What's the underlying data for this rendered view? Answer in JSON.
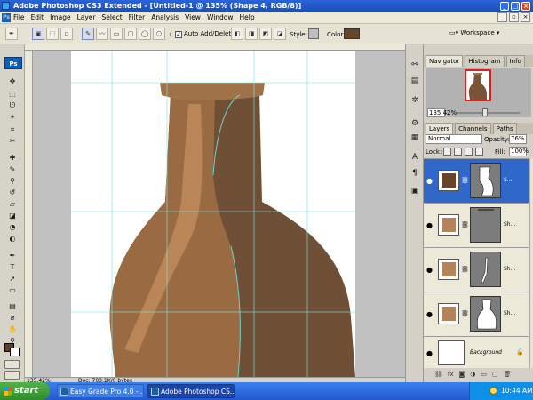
{
  "window": {
    "title": "Adobe Photoshop CS3 Extended - [Untitled-1 @ 135% (Shape 4, RGB/8)]",
    "controls": {
      "minimize": "_",
      "maximize": "□",
      "close": "×"
    }
  },
  "menubar": {
    "items": [
      "File",
      "Edit",
      "Image",
      "Layer",
      "Select",
      "Filter",
      "Analysis",
      "View",
      "Window",
      "Help"
    ],
    "doc_controls": {
      "minimize": "_",
      "restore": "▫",
      "close": "×"
    }
  },
  "options": {
    "auto_add_delete": "Auto Add/Delete",
    "auto_add_checked": true,
    "style_label": "Style:",
    "color_label": "Color:",
    "color_value": "#6a4428",
    "workspace": "Workspace"
  },
  "tools": {
    "badge": "Ps",
    "icons": [
      "move-icon",
      "marquee-icon",
      "lasso-icon",
      "magic-wand-icon",
      "crop-icon",
      "slice-icon",
      "healing-icon",
      "brush-icon",
      "stamp-icon",
      "history-brush-icon",
      "eraser-icon",
      "gradient-icon",
      "blur-icon",
      "dodge-icon",
      "pen-icon",
      "type-icon",
      "path-select-icon",
      "shape-icon",
      "notes-icon",
      "eyedropper-icon",
      "hand-icon",
      "zoom-icon"
    ]
  },
  "document": {
    "zoom": "135.42%",
    "doc_size": "Doc: 703.1K/0 bytes",
    "colors": {
      "dark": "#6f4f35",
      "mid": "#9a6b42",
      "light": "#c0895a"
    }
  },
  "navigator": {
    "tabs": [
      "Navigator",
      "Histogram",
      "Info"
    ],
    "zoom": "135.42%"
  },
  "layers": {
    "tabs": [
      "Layers",
      "Channels",
      "Paths"
    ],
    "blend_mode": "Normal",
    "opacity_label": "Opacity:",
    "opacity": "76%",
    "lock_label": "Lock:",
    "fill_label": "Fill:",
    "fill": "100%",
    "items": [
      {
        "name": "S...",
        "color": "#6a4428",
        "selected": true
      },
      {
        "name": "Sh...",
        "color": "#b5825a",
        "selected": false
      },
      {
        "name": "Sh...",
        "color": "#b5825a",
        "selected": false
      },
      {
        "name": "Sh...",
        "color": "#b5825a",
        "selected": false
      },
      {
        "name": "Background",
        "color": "#ffffff",
        "selected": false
      }
    ]
  },
  "taskbar": {
    "start": "start",
    "tasks": [
      "Easy Grade Pro 4.0 - ...",
      "Adobe Photoshop CS..."
    ],
    "clock": "10:44 AM"
  }
}
